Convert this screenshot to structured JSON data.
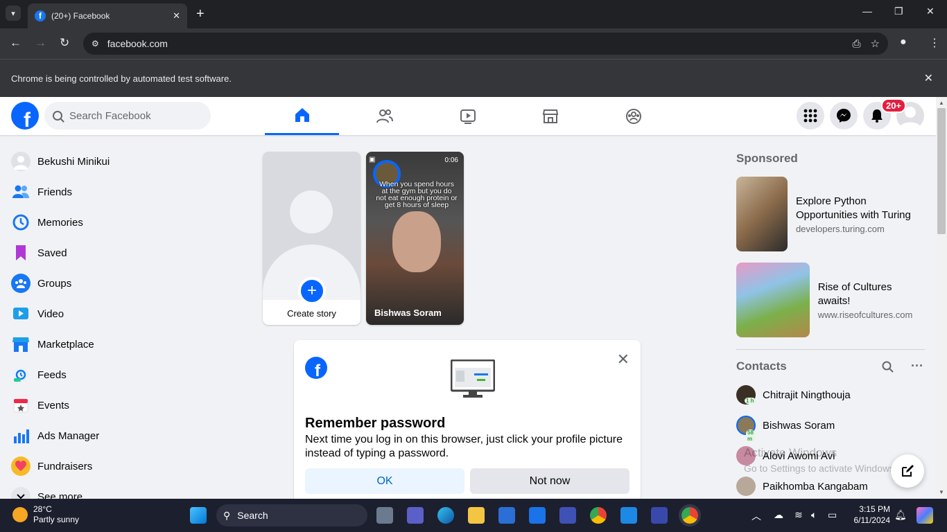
{
  "browser": {
    "tab_title": "(20+) Facebook",
    "url": "facebook.com",
    "infobar_message": "Chrome is being controlled by automated test software."
  },
  "fb_header": {
    "search_placeholder": "Search Facebook",
    "notification_badge": "20+",
    "nav_tabs": [
      "home",
      "friends",
      "video",
      "marketplace",
      "groups"
    ]
  },
  "sidebar": {
    "items": [
      {
        "label": "Bekushi Minikui",
        "icon": "profile-avatar"
      },
      {
        "label": "Friends",
        "icon": "friends-icon"
      },
      {
        "label": "Memories",
        "icon": "clock-icon"
      },
      {
        "label": "Saved",
        "icon": "bookmark-icon"
      },
      {
        "label": "Groups",
        "icon": "groups-icon"
      },
      {
        "label": "Video",
        "icon": "video-icon"
      },
      {
        "label": "Marketplace",
        "icon": "shop-icon"
      },
      {
        "label": "Feeds",
        "icon": "feeds-icon"
      },
      {
        "label": "Events",
        "icon": "calendar-icon"
      },
      {
        "label": "Ads Manager",
        "icon": "chart-icon"
      },
      {
        "label": "Fundraisers",
        "icon": "heart-icon"
      },
      {
        "label": "See more",
        "icon": "chevron-down-icon"
      }
    ]
  },
  "stories": {
    "create_label": "Create story",
    "friend_name": "Bishwas Soram",
    "friend_duration": "0:06",
    "friend_caption": "When you spend hours at the gym but you do not eat enough protein or get 8 hours of sleep"
  },
  "remember_password": {
    "title": "Remember password",
    "text": "Next time you log in on this browser, just click your profile picture instead of typing a password.",
    "ok_label": "OK",
    "not_now_label": "Not now"
  },
  "sponsored": {
    "title": "Sponsored",
    "ads": [
      {
        "title": "Explore Python Opportunities with Turing",
        "url": "developers.turing.com"
      },
      {
        "title": "Rise of Cultures awaits!",
        "url": "www.riseofcultures.com"
      }
    ]
  },
  "contacts": {
    "title": "Contacts",
    "people": [
      {
        "name": "Chitrajit Ningthouja",
        "status": "1 h"
      },
      {
        "name": "Bishwas Soram",
        "status": "58 m"
      },
      {
        "name": "Alovi Awomi Avi",
        "status": ""
      },
      {
        "name": "Paikhomba Kangabam",
        "status": ""
      }
    ]
  },
  "watermark": {
    "line1": "Activate Windows",
    "line2": "Go to Settings to activate Windows."
  },
  "taskbar": {
    "temperature": "28°C",
    "weather": "Partly sunny",
    "search_label": "Search",
    "time": "3:15 PM",
    "date": "6/11/2024"
  },
  "colors": {
    "fb_blue": "#0866ff",
    "badge_red": "#e41e3f"
  }
}
